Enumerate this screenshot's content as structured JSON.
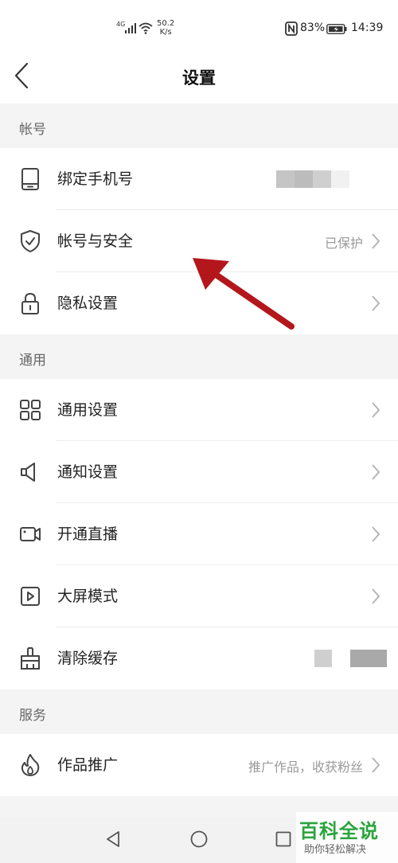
{
  "status_bar": {
    "network": "4G",
    "speed_value": "50.2",
    "speed_unit": "K/s",
    "battery_percent": "83%",
    "time": "14:39"
  },
  "header": {
    "title": "设置"
  },
  "sections": {
    "account": {
      "title": "帐号",
      "rows": [
        {
          "label": "绑定手机号",
          "icon": "phone-icon"
        },
        {
          "label": "帐号与安全",
          "value": "已保护",
          "icon": "shield-icon"
        },
        {
          "label": "隐私设置",
          "icon": "lock-icon"
        }
      ]
    },
    "general": {
      "title": "通用",
      "rows": [
        {
          "label": "通用设置",
          "icon": "grid-icon"
        },
        {
          "label": "通知设置",
          "icon": "speaker-icon"
        },
        {
          "label": "开通直播",
          "icon": "video-camera-icon"
        },
        {
          "label": "大屏模式",
          "icon": "play-icon"
        },
        {
          "label": "清除缓存",
          "icon": "broom-icon"
        }
      ]
    },
    "service": {
      "title": "服务",
      "rows": [
        {
          "label": "作品推广",
          "value": "推广作品，收获粉丝",
          "icon": "flame-icon"
        }
      ]
    }
  },
  "watermark": {
    "title": "百科全说",
    "subtitle": "助你轻松解决"
  },
  "colors": {
    "accent_arrow": "#b3171c",
    "watermark_green": "#2aa43c"
  }
}
